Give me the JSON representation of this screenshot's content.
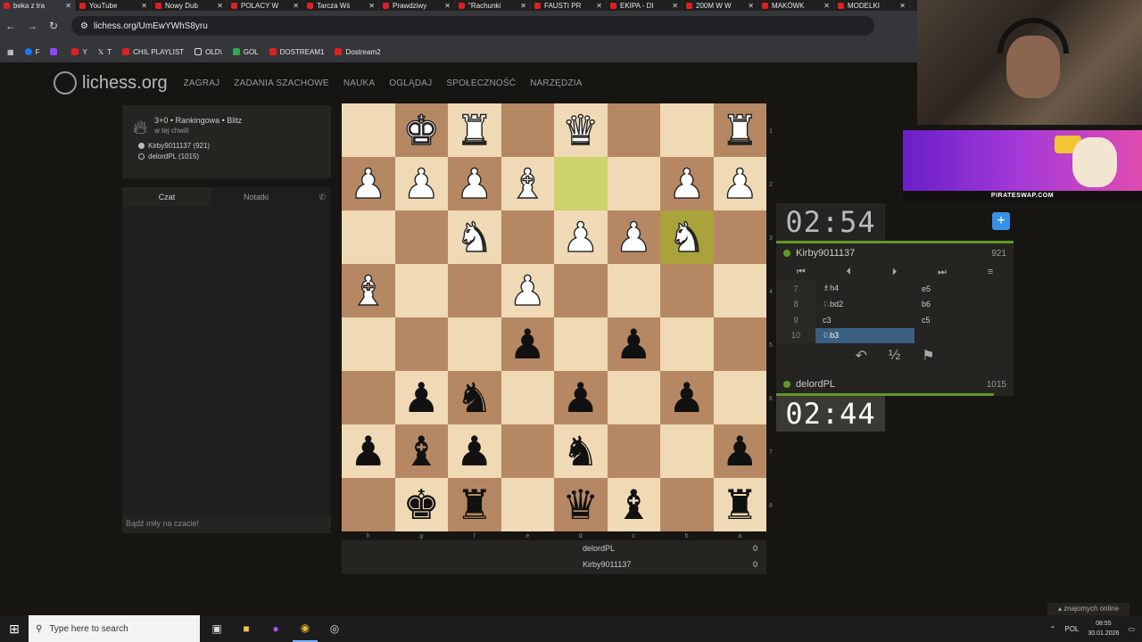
{
  "browser": {
    "tabs": [
      {
        "label": "beka z tra"
      },
      {
        "label": "YouTube"
      },
      {
        "label": "Nowy Dub"
      },
      {
        "label": "POLACY W"
      },
      {
        "label": "Tarcza Wś"
      },
      {
        "label": "Prawdziwy"
      },
      {
        "label": "\"Rachunki"
      },
      {
        "label": "FAUSTI PR"
      },
      {
        "label": "EKIPA - DI"
      },
      {
        "label": "200M W W"
      },
      {
        "label": "MAKÓWK"
      },
      {
        "label": "MODELKI"
      }
    ],
    "url": "lichess.org/UmEwYWhS8yru",
    "bookmarks": [
      {
        "label": "F",
        "icon": "facebook-icon"
      },
      {
        "label": "",
        "icon": "twitch-icon"
      },
      {
        "label": "Y",
        "icon": "youtube-icon"
      },
      {
        "label": "T",
        "icon": "x-icon"
      },
      {
        "label": "CHIL PLAYLIST",
        "icon": "youtube-icon"
      },
      {
        "label": "OLD\\",
        "icon": "folder-icon"
      },
      {
        "label": "GOL",
        "icon": "g-icon"
      },
      {
        "label": "DOSTREAM1",
        "icon": "youtube-icon"
      },
      {
        "label": "Dostream2",
        "icon": "youtube-icon"
      }
    ]
  },
  "header": {
    "logo": "lichess.org",
    "nav": [
      "ZAGRAJ",
      "ZADANIA SZACHOWE",
      "NAUKA",
      "OGLĄDAJ",
      "SPOŁECZNOŚĆ",
      "NARZĘDZIA"
    ]
  },
  "game_info": {
    "title": "3+0 • Rankingowa • Blitz",
    "time": "w tej chwili",
    "white_player": "Kirby9011137 (921)",
    "black_player": "delordPL (1015)"
  },
  "chat": {
    "tab_chat": "Czat",
    "tab_notes": "Notatki",
    "input_placeholder": "Bądź miły na czacie!"
  },
  "board": {
    "orientation": "black",
    "highlight": [
      "d2",
      "b3"
    ],
    "ranks": [
      "1",
      "2",
      "3",
      "4",
      "5",
      "6",
      "7",
      "8"
    ],
    "files": [
      "h",
      "g",
      "f",
      "e",
      "d",
      "c",
      "b",
      "a"
    ],
    "rows": [
      [
        "",
        "K",
        "R",
        "",
        "Q",
        "",
        "",
        "R"
      ],
      [
        "P",
        "P",
        "P",
        "B",
        "",
        "",
        "P",
        "P"
      ],
      [
        "",
        "",
        "N",
        "",
        "P",
        "P",
        "N",
        ""
      ],
      [
        "B",
        "",
        "",
        "P",
        "",
        "",
        "",
        ""
      ],
      [
        "",
        "",
        "",
        "p",
        "",
        "p",
        "",
        ""
      ],
      [
        "",
        "p",
        "n",
        "",
        "p",
        "",
        "p",
        ""
      ],
      [
        "p",
        "b",
        "p",
        "",
        "n",
        "",
        "",
        "p"
      ],
      [
        "",
        "k",
        "r",
        "",
        "q",
        "b",
        "",
        "r"
      ]
    ]
  },
  "score": {
    "rows": [
      {
        "name": "delordPL",
        "score": "0"
      },
      {
        "name": "Kirby9011137",
        "score": "0"
      }
    ]
  },
  "clocks": {
    "top": "02:54",
    "bottom": "02:44"
  },
  "players": {
    "top_name": "Kirby9011137",
    "top_rating": "921",
    "bottom_name": "delordPL",
    "bottom_rating": "1015"
  },
  "moves": [
    {
      "num": "7",
      "white": "♗h4",
      "black": "e5"
    },
    {
      "num": "8",
      "white": "♘bd2",
      "black": "b6"
    },
    {
      "num": "9",
      "white": "c3",
      "black": "c5"
    },
    {
      "num": "10",
      "white": "♘b3",
      "black": ""
    }
  ],
  "overlay": {
    "banner_url": "PIRATESWAP.COM"
  },
  "friends": "znajomych online",
  "taskbar": {
    "search_placeholder": "Type here to search",
    "lang": "POL",
    "time": "08:55",
    "date": "30.01.2026"
  },
  "colors": {
    "light_square": "#f0d9b5",
    "dark_square": "#b58863",
    "accent_green": "#629924",
    "accent_blue": "#3692e7"
  }
}
